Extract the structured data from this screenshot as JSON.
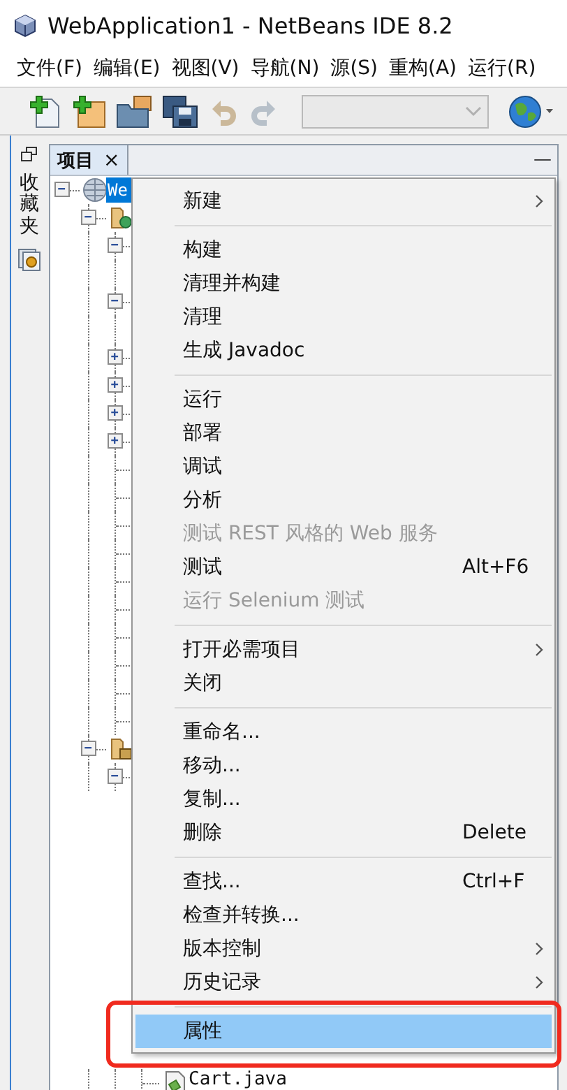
{
  "window": {
    "title": "WebApplication1 - NetBeans IDE 8.2"
  },
  "menu_bar": [
    "文件(F)",
    "编辑(E)",
    "视图(V)",
    "导航(N)",
    "源(S)",
    "重构(A)",
    "运行(R)"
  ],
  "toolbar": {
    "buttons": [
      {
        "kind": "new-file",
        "disabled": false
      },
      {
        "kind": "new-project",
        "disabled": false
      },
      {
        "kind": "open-project",
        "disabled": false
      },
      {
        "kind": "save-all",
        "disabled": false
      },
      {
        "kind": "undo",
        "disabled": true
      },
      {
        "kind": "redo",
        "disabled": true
      },
      {
        "kind": "combo",
        "disabled": true
      },
      {
        "kind": "globe",
        "disabled": false
      }
    ]
  },
  "side_strip": {
    "label": "收藏夹"
  },
  "panel": {
    "tab": {
      "label": "项目",
      "close": "×",
      "selected": true
    },
    "minimize": "—"
  },
  "tree": [
    {
      "kind": "project",
      "label": "We",
      "selected": true,
      "expanded": true,
      "children": [
        {
          "kind": "web-folder",
          "expanded": true,
          "children": [
            {
              "kind": "node",
              "expanded": true,
              "children": [
                {
                  "kind": "leaf"
                }
              ]
            },
            {
              "kind": "node",
              "expanded": true,
              "children": [
                {
                  "kind": "leaf"
                }
              ]
            },
            {
              "kind": "node",
              "expanded": false
            },
            {
              "kind": "node",
              "expanded": false
            },
            {
              "kind": "node",
              "expanded": false
            },
            {
              "kind": "node",
              "expanded": false
            },
            {
              "kind": "leaf"
            },
            {
              "kind": "leaf"
            },
            {
              "kind": "leaf"
            },
            {
              "kind": "leaf"
            },
            {
              "kind": "leaf"
            },
            {
              "kind": "leaf"
            },
            {
              "kind": "leaf"
            },
            {
              "kind": "leaf"
            },
            {
              "kind": "leaf"
            },
            {
              "kind": "leaf"
            }
          ]
        },
        {
          "kind": "package-folder",
          "expanded": true,
          "children": [
            {
              "kind": "node",
              "expanded": true,
              "children": [
                {
                  "kind": "java-file",
                  "label": "Cart.java",
                  "selected": false
                }
              ]
            }
          ]
        }
      ]
    }
  ],
  "context_menu": [
    {
      "kind": "item",
      "label": "新建",
      "submenu": true,
      "disabled": false,
      "selected": false
    },
    {
      "kind": "separator"
    },
    {
      "kind": "item",
      "label": "构建",
      "submenu": false,
      "disabled": false,
      "selected": false
    },
    {
      "kind": "item",
      "label": "清理并构建",
      "submenu": false,
      "disabled": false,
      "selected": false
    },
    {
      "kind": "item",
      "label": "清理",
      "submenu": false,
      "disabled": false,
      "selected": false
    },
    {
      "kind": "item",
      "label": "生成 Javadoc",
      "submenu": false,
      "disabled": false,
      "selected": false
    },
    {
      "kind": "separator"
    },
    {
      "kind": "item",
      "label": "运行",
      "submenu": false,
      "disabled": false,
      "selected": false
    },
    {
      "kind": "item",
      "label": "部署",
      "submenu": false,
      "disabled": false,
      "selected": false
    },
    {
      "kind": "item",
      "label": "调试",
      "submenu": false,
      "disabled": false,
      "selected": false
    },
    {
      "kind": "item",
      "label": "分析",
      "submenu": false,
      "disabled": false,
      "selected": false
    },
    {
      "kind": "item",
      "label": "测试 REST 风格的 Web 服务",
      "submenu": false,
      "disabled": true,
      "selected": false
    },
    {
      "kind": "item",
      "label": "测试",
      "shortcut": "Alt+F6",
      "submenu": false,
      "disabled": false,
      "selected": false
    },
    {
      "kind": "item",
      "label": "运行 Selenium 测试",
      "submenu": false,
      "disabled": true,
      "selected": false
    },
    {
      "kind": "separator"
    },
    {
      "kind": "item",
      "label": "打开必需项目",
      "submenu": true,
      "disabled": false,
      "selected": false
    },
    {
      "kind": "item",
      "label": "关闭",
      "submenu": false,
      "disabled": false,
      "selected": false
    },
    {
      "kind": "separator"
    },
    {
      "kind": "item",
      "label": "重命名...",
      "submenu": false,
      "disabled": false,
      "selected": false
    },
    {
      "kind": "item",
      "label": "移动...",
      "submenu": false,
      "disabled": false,
      "selected": false
    },
    {
      "kind": "item",
      "label": "复制...",
      "submenu": false,
      "disabled": false,
      "selected": false
    },
    {
      "kind": "item",
      "label": "删除",
      "shortcut": "Delete",
      "submenu": false,
      "disabled": false,
      "selected": false
    },
    {
      "kind": "separator"
    },
    {
      "kind": "item",
      "label": "查找...",
      "shortcut": "Ctrl+F",
      "submenu": false,
      "disabled": false,
      "selected": false
    },
    {
      "kind": "item",
      "label": "检查并转换...",
      "submenu": false,
      "disabled": false,
      "selected": false
    },
    {
      "kind": "item",
      "label": "版本控制",
      "submenu": true,
      "disabled": false,
      "selected": false
    },
    {
      "kind": "item",
      "label": "历史记录",
      "submenu": true,
      "disabled": false,
      "selected": false
    },
    {
      "kind": "separator"
    },
    {
      "kind": "item",
      "label": "属性",
      "submenu": false,
      "disabled": false,
      "selected": true
    }
  ],
  "annotation": {
    "kind": "highlight-frame"
  }
}
